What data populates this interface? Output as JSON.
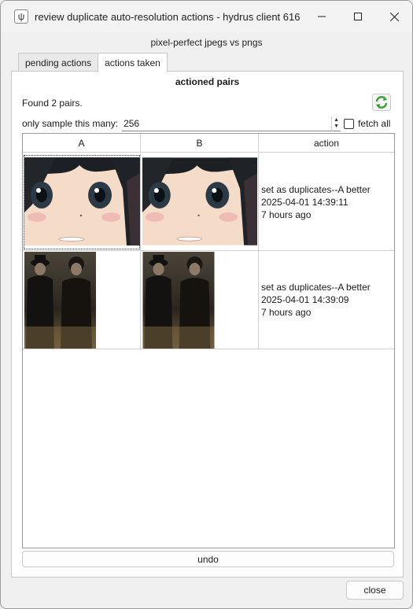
{
  "window": {
    "title": "review duplicate auto-resolution actions - hydrus client 616",
    "app_icon_glyph": "ψ"
  },
  "subtitle": "pixel-perfect jpegs vs pngs",
  "tabs": [
    {
      "label": "pending actions",
      "active": false
    },
    {
      "label": "actions taken",
      "active": true
    }
  ],
  "panel": {
    "title": "actioned pairs",
    "found_text": "Found 2 pairs.",
    "sample_label": "only sample this many:",
    "sample_value": "256",
    "fetch_all_label": "fetch all",
    "fetch_all_checked": false
  },
  "table": {
    "columns": [
      "A",
      "B",
      "action"
    ],
    "rows": [
      {
        "a_thumb": "anime-face-thumbnail",
        "b_thumb": "anime-face-thumbnail",
        "action": "set as duplicates--A better",
        "timestamp": "2025-04-01 14:39:11",
        "ago": "7 hours ago"
      },
      {
        "a_thumb": "two-men-photo-thumbnail",
        "b_thumb": "two-men-photo-thumbnail",
        "action": "set as duplicates--A better",
        "timestamp": "2025-04-01 14:39:09",
        "ago": "7 hours ago"
      }
    ]
  },
  "buttons": {
    "undo": "undo",
    "close": "close"
  },
  "icons": {
    "refresh": "refresh-icon",
    "minimize": "minimize-icon",
    "maximize": "maximize-icon",
    "close": "close-icon"
  },
  "colors": {
    "refresh_green": "#3aa235"
  }
}
